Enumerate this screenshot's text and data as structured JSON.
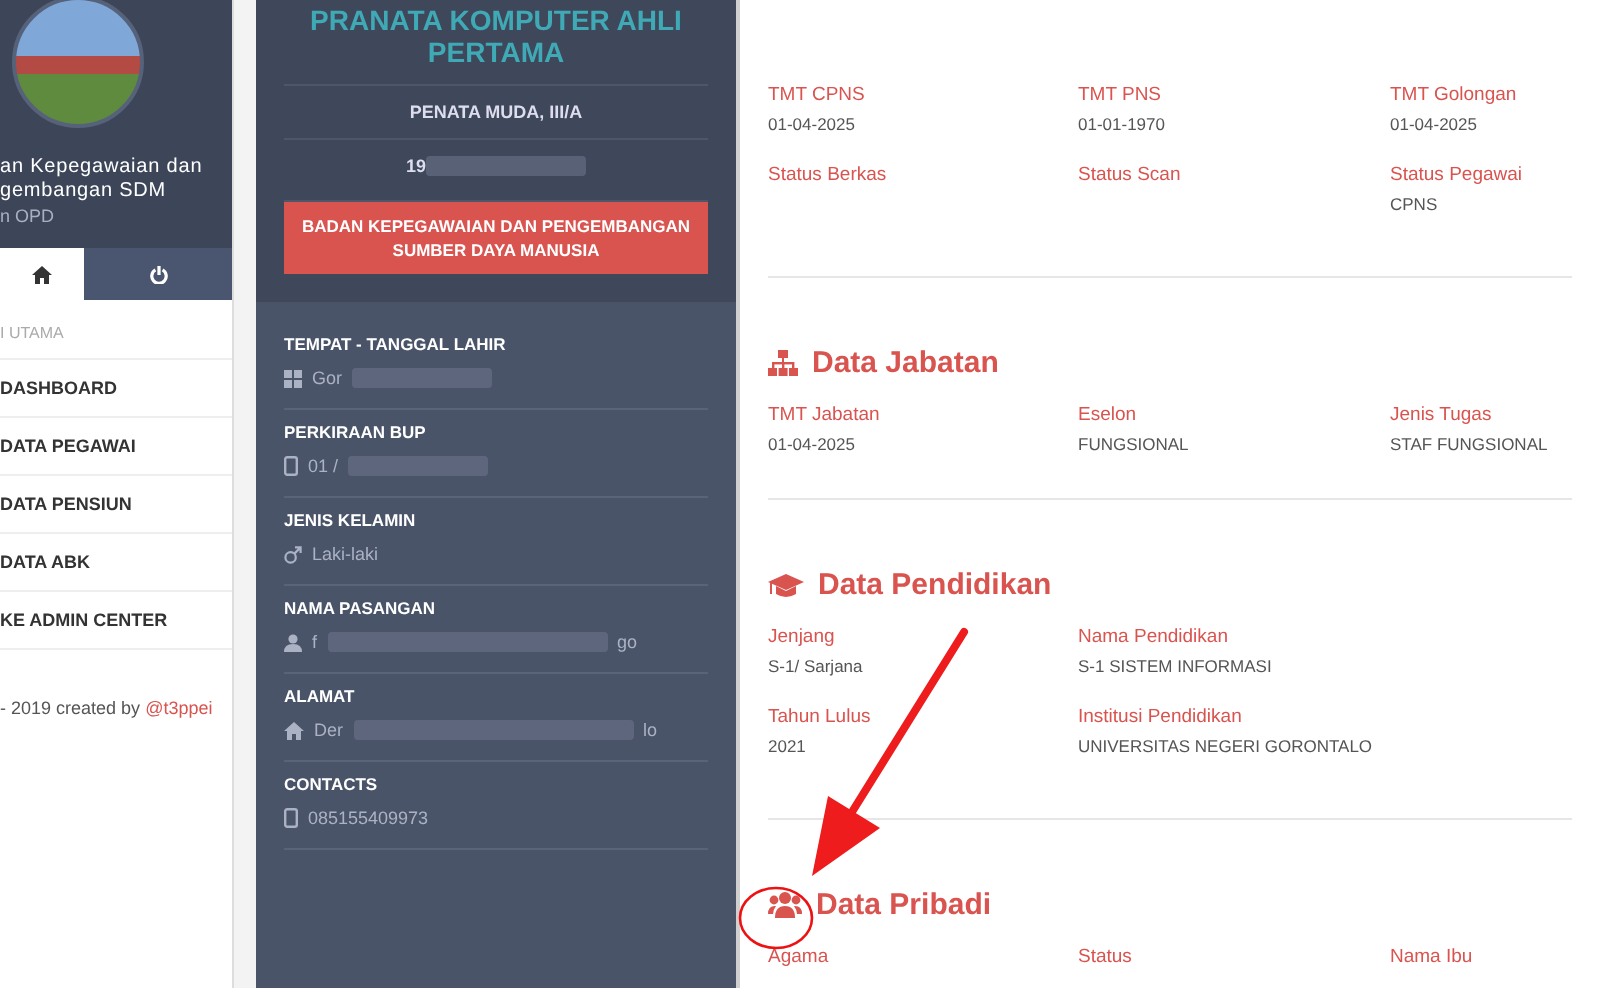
{
  "sidebar": {
    "org_lines": [
      "an Kepegawaian dan",
      "gembangan SDM"
    ],
    "org_sub": "n OPD",
    "tabs": [
      {
        "kind": "home",
        "selected": true
      },
      {
        "kind": "power",
        "selected": false
      }
    ],
    "menu_header": "I UTAMA",
    "menu": [
      {
        "label": "DASHBOARD"
      },
      {
        "label": "DATA PEGAWAI"
      },
      {
        "label": "DATA PENSIUN"
      },
      {
        "label": "DATA ABK"
      },
      {
        "label": "KE ADMIN CENTER"
      }
    ],
    "footer": {
      "text": "- 2019 created by",
      "link": "@t3ppei"
    }
  },
  "profile": {
    "title_lines": [
      "PRANATA KOMPUTER AHLI",
      "PERTAMA"
    ],
    "rank": "PENATA MUDA, III/A",
    "nip": {
      "shown": "19",
      "hidden": true
    },
    "unit": "BADAN KEPEGAWAIAN DAN PENGEMBANGAN SUMBER DAYA MANUSIA",
    "items": [
      {
        "label": "TEMPAT - TANGGAL LAHIR",
        "kind": "place",
        "before": "Gor",
        "hidden": true
      },
      {
        "label": "PERKIRAAN BUP",
        "kind": "phone",
        "before": "01 /",
        "hidden": true
      },
      {
        "label": "JENIS KELAMIN",
        "kind": "male",
        "before": "Laki-laki",
        "hidden": false
      },
      {
        "label": "NAMA PASANGAN",
        "kind": "user",
        "before": "f",
        "after": "go",
        "hidden": true
      },
      {
        "label": "ALAMAT",
        "kind": "home",
        "before": "Der",
        "after": "lo",
        "hidden": true
      },
      {
        "label": "CONTACTS",
        "kind": "phone",
        "before": "085155409973",
        "hidden": false
      }
    ]
  },
  "sections": [
    {
      "rows": [
        [
          {
            "label": "TMT CPNS",
            "value": "01-04-2025"
          },
          {
            "label": "TMT PNS",
            "value": "01-01-1970"
          },
          {
            "label": "TMT Golongan",
            "value": "01-04-2025"
          }
        ],
        [
          {
            "label": "Status Berkas"
          },
          {
            "label": "Status Scan"
          },
          {
            "label": "Status Pegawai",
            "value": "CPNS"
          }
        ]
      ]
    },
    {
      "title": "Data Jabatan",
      "kind": "sitemap",
      "rows": [
        [
          {
            "label": "TMT Jabatan",
            "value": "01-04-2025"
          },
          {
            "label": "Eselon",
            "value": "FUNGSIONAL"
          },
          {
            "label": "Jenis Tugas",
            "value": "STAF FUNGSIONAL"
          }
        ]
      ]
    },
    {
      "title": "Data Pendidikan",
      "kind": "graduation",
      "rows": [
        [
          {
            "label": "Jenjang",
            "value": "S-1/ Sarjana"
          },
          {
            "label": "Nama Pendidikan",
            "value": "S-1 SISTEM INFORMASI"
          }
        ],
        [
          {
            "label": "Tahun Lulus",
            "value": "2021"
          },
          {
            "label": "Institusi Pendidikan",
            "value": "UNIVERSITAS NEGERI GORONTALO"
          }
        ]
      ]
    },
    {
      "title": "Data Pribadi",
      "kind": "users",
      "rows": [
        [
          {
            "label": "Agama"
          },
          {
            "label": "Status"
          },
          {
            "label": "Nama Ibu"
          }
        ]
      ]
    }
  ]
}
